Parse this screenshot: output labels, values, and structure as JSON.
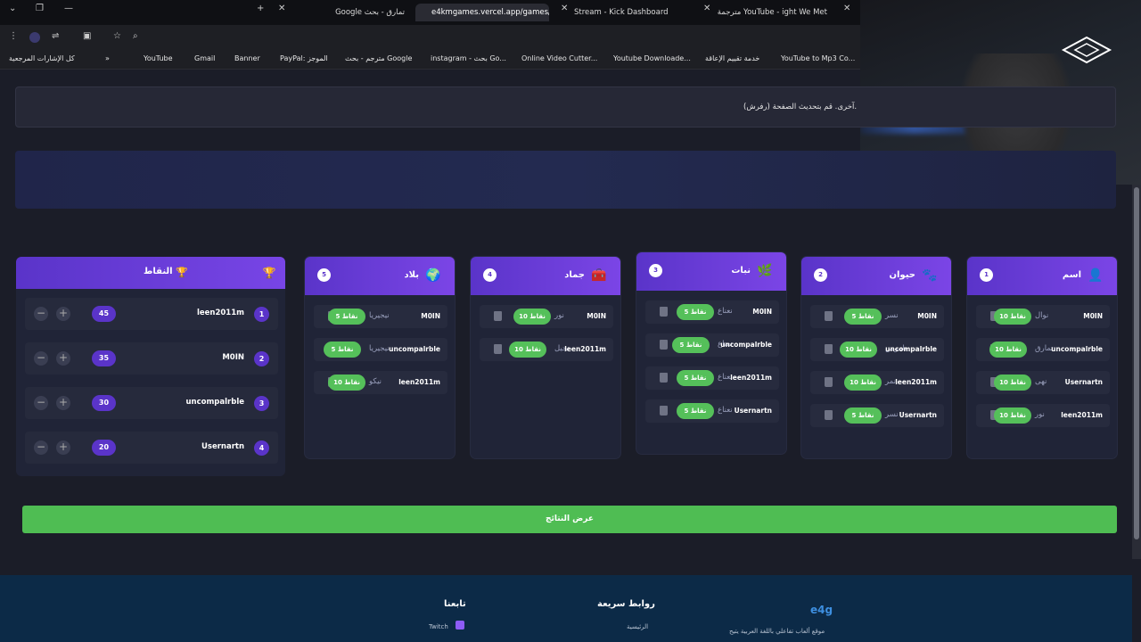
{
  "browser": {
    "tabs": [
      {
        "label": "Google تمارق - بحث",
        "active": false
      },
      {
        "label": "e4kmgames.vercel.app/games/",
        "active": true
      },
      {
        "label": "Stream - Kick Dashboard",
        "active": false
      },
      {
        "label": "مترجمة YouTube - ight We Met",
        "active": false
      }
    ],
    "bookmarks": [
      "كل الإشارات المرجعية",
      "YouTube",
      "Gmail",
      "Banner",
      "PayPal: الموجز",
      "مترجم - بحث Google",
      "instagram - بحث Go...",
      "Online Video Cutter...",
      "Youtube Downloade...",
      "خدمة تقييم الإعاقة",
      "YouTube to Mp3 Co..."
    ]
  },
  "notice": {
    "text": "آخرى. قم بتحديث الصفحة (رفرش)."
  },
  "columns": [
    {
      "num": "1",
      "title": "اسم",
      "icon": "person-icon",
      "rows": [
        {
          "player": "M0IN",
          "answer": "نوال",
          "points": "10 نقاط"
        },
        {
          "player": "uncompalrble",
          "answer": "تمارق",
          "points": "10 نقاط"
        },
        {
          "player": "Usernartn",
          "answer": "نهى",
          "points": "10 نقاط"
        },
        {
          "player": "leen2011m",
          "answer": "نور",
          "points": "10 نقاط"
        }
      ]
    },
    {
      "num": "2",
      "title": "حيوان",
      "icon": "paw-icon",
      "rows": [
        {
          "player": "M0IN",
          "answer": "نسر",
          "points": "5 نقاط"
        },
        {
          "player": "uncompalrble",
          "answer": "ناموس",
          "points": "10 نقاط"
        },
        {
          "player": "leen2011m",
          "answer": "نمر",
          "points": "10 نقاط"
        },
        {
          "player": "Usernartn",
          "answer": "نسر",
          "points": "5 نقاط"
        }
      ]
    },
    {
      "num": "3",
      "title": "نبات",
      "icon": "leaf-icon",
      "rows": [
        {
          "player": "M0IN",
          "answer": "نعناع",
          "points": "5 نقاط"
        },
        {
          "player": "uncompalrble",
          "answer": "نعناع",
          "points": "5 نقاط"
        },
        {
          "player": "leen2011m",
          "answer": "نعناع",
          "points": "5 نقاط"
        },
        {
          "player": "Usernartn",
          "answer": "نعناع",
          "points": "5 نقاط"
        }
      ]
    },
    {
      "num": "4",
      "title": "جماد",
      "icon": "toolbox-icon",
      "rows": [
        {
          "player": "M0IN",
          "answer": "نور",
          "points": "10 نقاط"
        },
        {
          "player": "leen2011m",
          "answer": "نجيل",
          "points": "10 نقاط"
        }
      ]
    },
    {
      "num": "5",
      "title": "بلاد",
      "icon": "globe-icon",
      "rows": [
        {
          "player": "M0IN",
          "answer": "نيجيريا",
          "points": "5 نقاط"
        },
        {
          "player": "uncompalrble",
          "answer": "نيجيريا",
          "points": "5 نقاط"
        },
        {
          "player": "leen2011m",
          "answer": "نيكو",
          "points": "10 نقاط"
        }
      ]
    }
  ],
  "scoreboard": {
    "title": "النقاط",
    "players": [
      {
        "rank": "1",
        "name": "leen2011m",
        "score": "45"
      },
      {
        "rank": "2",
        "name": "M0IN",
        "score": "35"
      },
      {
        "rank": "3",
        "name": "uncompalrble",
        "score": "30"
      },
      {
        "rank": "4",
        "name": "Usernartn",
        "score": "20"
      }
    ]
  },
  "show_results": "عرض النتائج",
  "footer": {
    "brand": "e4g",
    "tagline": "موقع ألعاب تفاعلي باللغة العربية يتيح",
    "quick_links_title": "روابط سريعة",
    "home_link": "الرئيسية",
    "follow_title": "تابعنا",
    "twitch": "Twitch"
  }
}
